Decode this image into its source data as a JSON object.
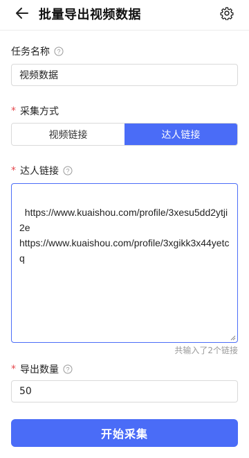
{
  "header": {
    "title": "批量导出视频数据",
    "back_icon": "arrow-left-icon",
    "settings_icon": "gear-icon"
  },
  "task_name": {
    "label": "任务名称",
    "value": "视频数据"
  },
  "collect_method": {
    "label": "采集方式",
    "required": "*",
    "options": [
      "视频链接",
      "达人链接"
    ],
    "selected": "达人链接"
  },
  "creator_links": {
    "label": "达人链接",
    "required": "*",
    "value": "https://www.kuaishou.com/profile/3xesu5dd2ytji2e\nhttps://www.kuaishou.com/profile/3xgikk3x44yetcq",
    "counter": "共输入了2个链接"
  },
  "export_count": {
    "label": "导出数量",
    "required": "*",
    "value": "50"
  },
  "submit": {
    "label": "开始采集"
  },
  "colors": {
    "accent": "#4a6cf7",
    "required": "#e5484d"
  }
}
